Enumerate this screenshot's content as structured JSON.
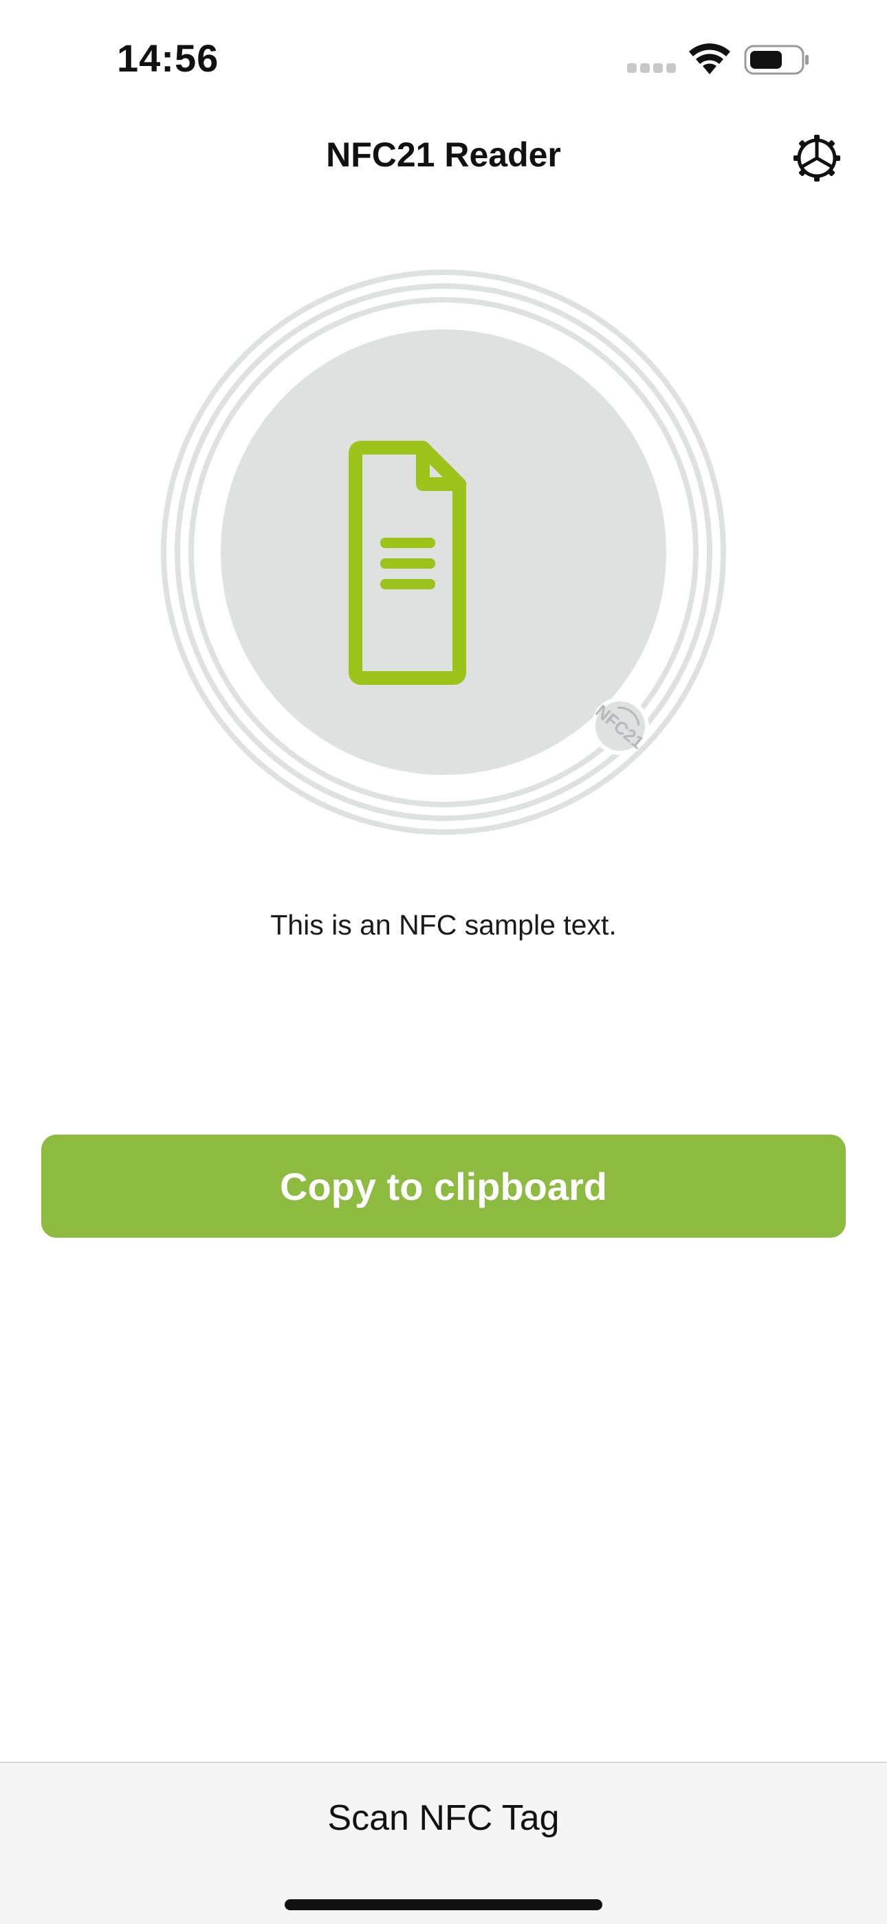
{
  "status_bar": {
    "time": "14:56",
    "icons": [
      "cellular-signal-icon",
      "wifi-icon",
      "battery-icon"
    ]
  },
  "nav": {
    "title": "NFC21 Reader",
    "settings_icon": "gear-icon"
  },
  "hero": {
    "icon": "document-icon",
    "badge_text": "NFC21",
    "message": "This is an NFC sample text."
  },
  "actions": {
    "copy_label": "Copy to clipboard"
  },
  "bottom_bar": {
    "scan_label": "Scan NFC Tag"
  },
  "colors": {
    "accent": "#8cbb3f",
    "icon_green": "#9bc31a",
    "circle_gray": "#dfe1e1",
    "bottom_bar_bg": "#f5f5f5"
  }
}
